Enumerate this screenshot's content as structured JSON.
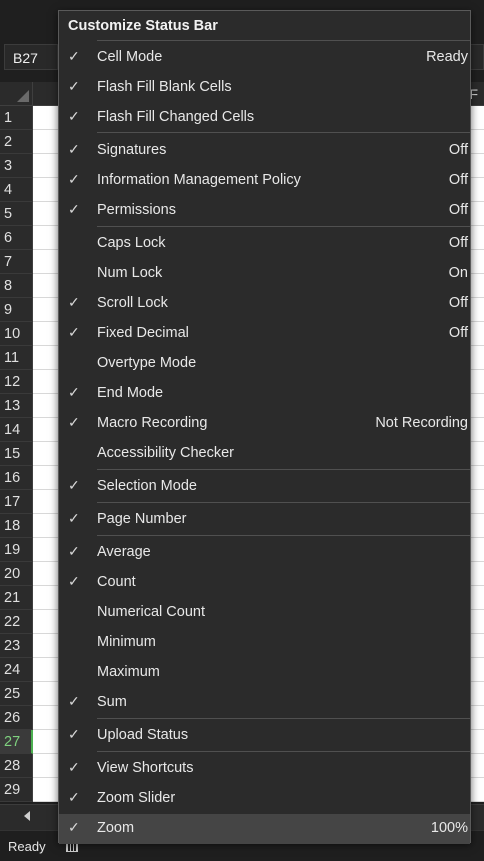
{
  "name_box": {
    "value": "B27"
  },
  "column_header_visible": "F",
  "row_numbers": [
    "1",
    "2",
    "3",
    "4",
    "5",
    "6",
    "7",
    "8",
    "9",
    "10",
    "11",
    "12",
    "13",
    "14",
    "15",
    "16",
    "17",
    "18",
    "19",
    "20",
    "21",
    "22",
    "23",
    "24",
    "25",
    "26",
    "27",
    "28",
    "29"
  ],
  "selected_row": "27",
  "status_bar": {
    "ready_text": "Ready"
  },
  "menu": {
    "title": "Customize Status Bar",
    "items": [
      {
        "label": "Cell Mode",
        "value": "Ready",
        "checked": true
      },
      {
        "label": "Flash Fill Blank Cells",
        "value": "",
        "checked": true
      },
      {
        "label": "Flash Fill Changed Cells",
        "value": "",
        "checked": true
      },
      {
        "label": "Signatures",
        "value": "Off",
        "checked": true
      },
      {
        "label": "Information Management Policy",
        "value": "Off",
        "checked": true
      },
      {
        "label": "Permissions",
        "value": "Off",
        "checked": true
      },
      {
        "label": "Caps Lock",
        "value": "Off",
        "checked": false
      },
      {
        "label": "Num Lock",
        "value": "On",
        "checked": false
      },
      {
        "label": "Scroll Lock",
        "value": "Off",
        "checked": true
      },
      {
        "label": "Fixed Decimal",
        "value": "Off",
        "checked": true
      },
      {
        "label": "Overtype Mode",
        "value": "",
        "checked": false
      },
      {
        "label": "End Mode",
        "value": "",
        "checked": true
      },
      {
        "label": "Macro Recording",
        "value": "Not Recording",
        "checked": true
      },
      {
        "label": "Accessibility Checker",
        "value": "",
        "checked": false
      },
      {
        "label": "Selection Mode",
        "value": "",
        "checked": true
      },
      {
        "label": "Page Number",
        "value": "",
        "checked": true
      },
      {
        "label": "Average",
        "value": "",
        "checked": true
      },
      {
        "label": "Count",
        "value": "",
        "checked": true
      },
      {
        "label": "Numerical Count",
        "value": "",
        "checked": false
      },
      {
        "label": "Minimum",
        "value": "",
        "checked": false
      },
      {
        "label": "Maximum",
        "value": "",
        "checked": false
      },
      {
        "label": "Sum",
        "value": "",
        "checked": true
      },
      {
        "label": "Upload Status",
        "value": "",
        "checked": true
      },
      {
        "label": "View Shortcuts",
        "value": "",
        "checked": true
      },
      {
        "label": "Zoom Slider",
        "value": "",
        "checked": true
      },
      {
        "label": "Zoom",
        "value": "100%",
        "checked": true
      }
    ],
    "check_glyph": "✓"
  }
}
